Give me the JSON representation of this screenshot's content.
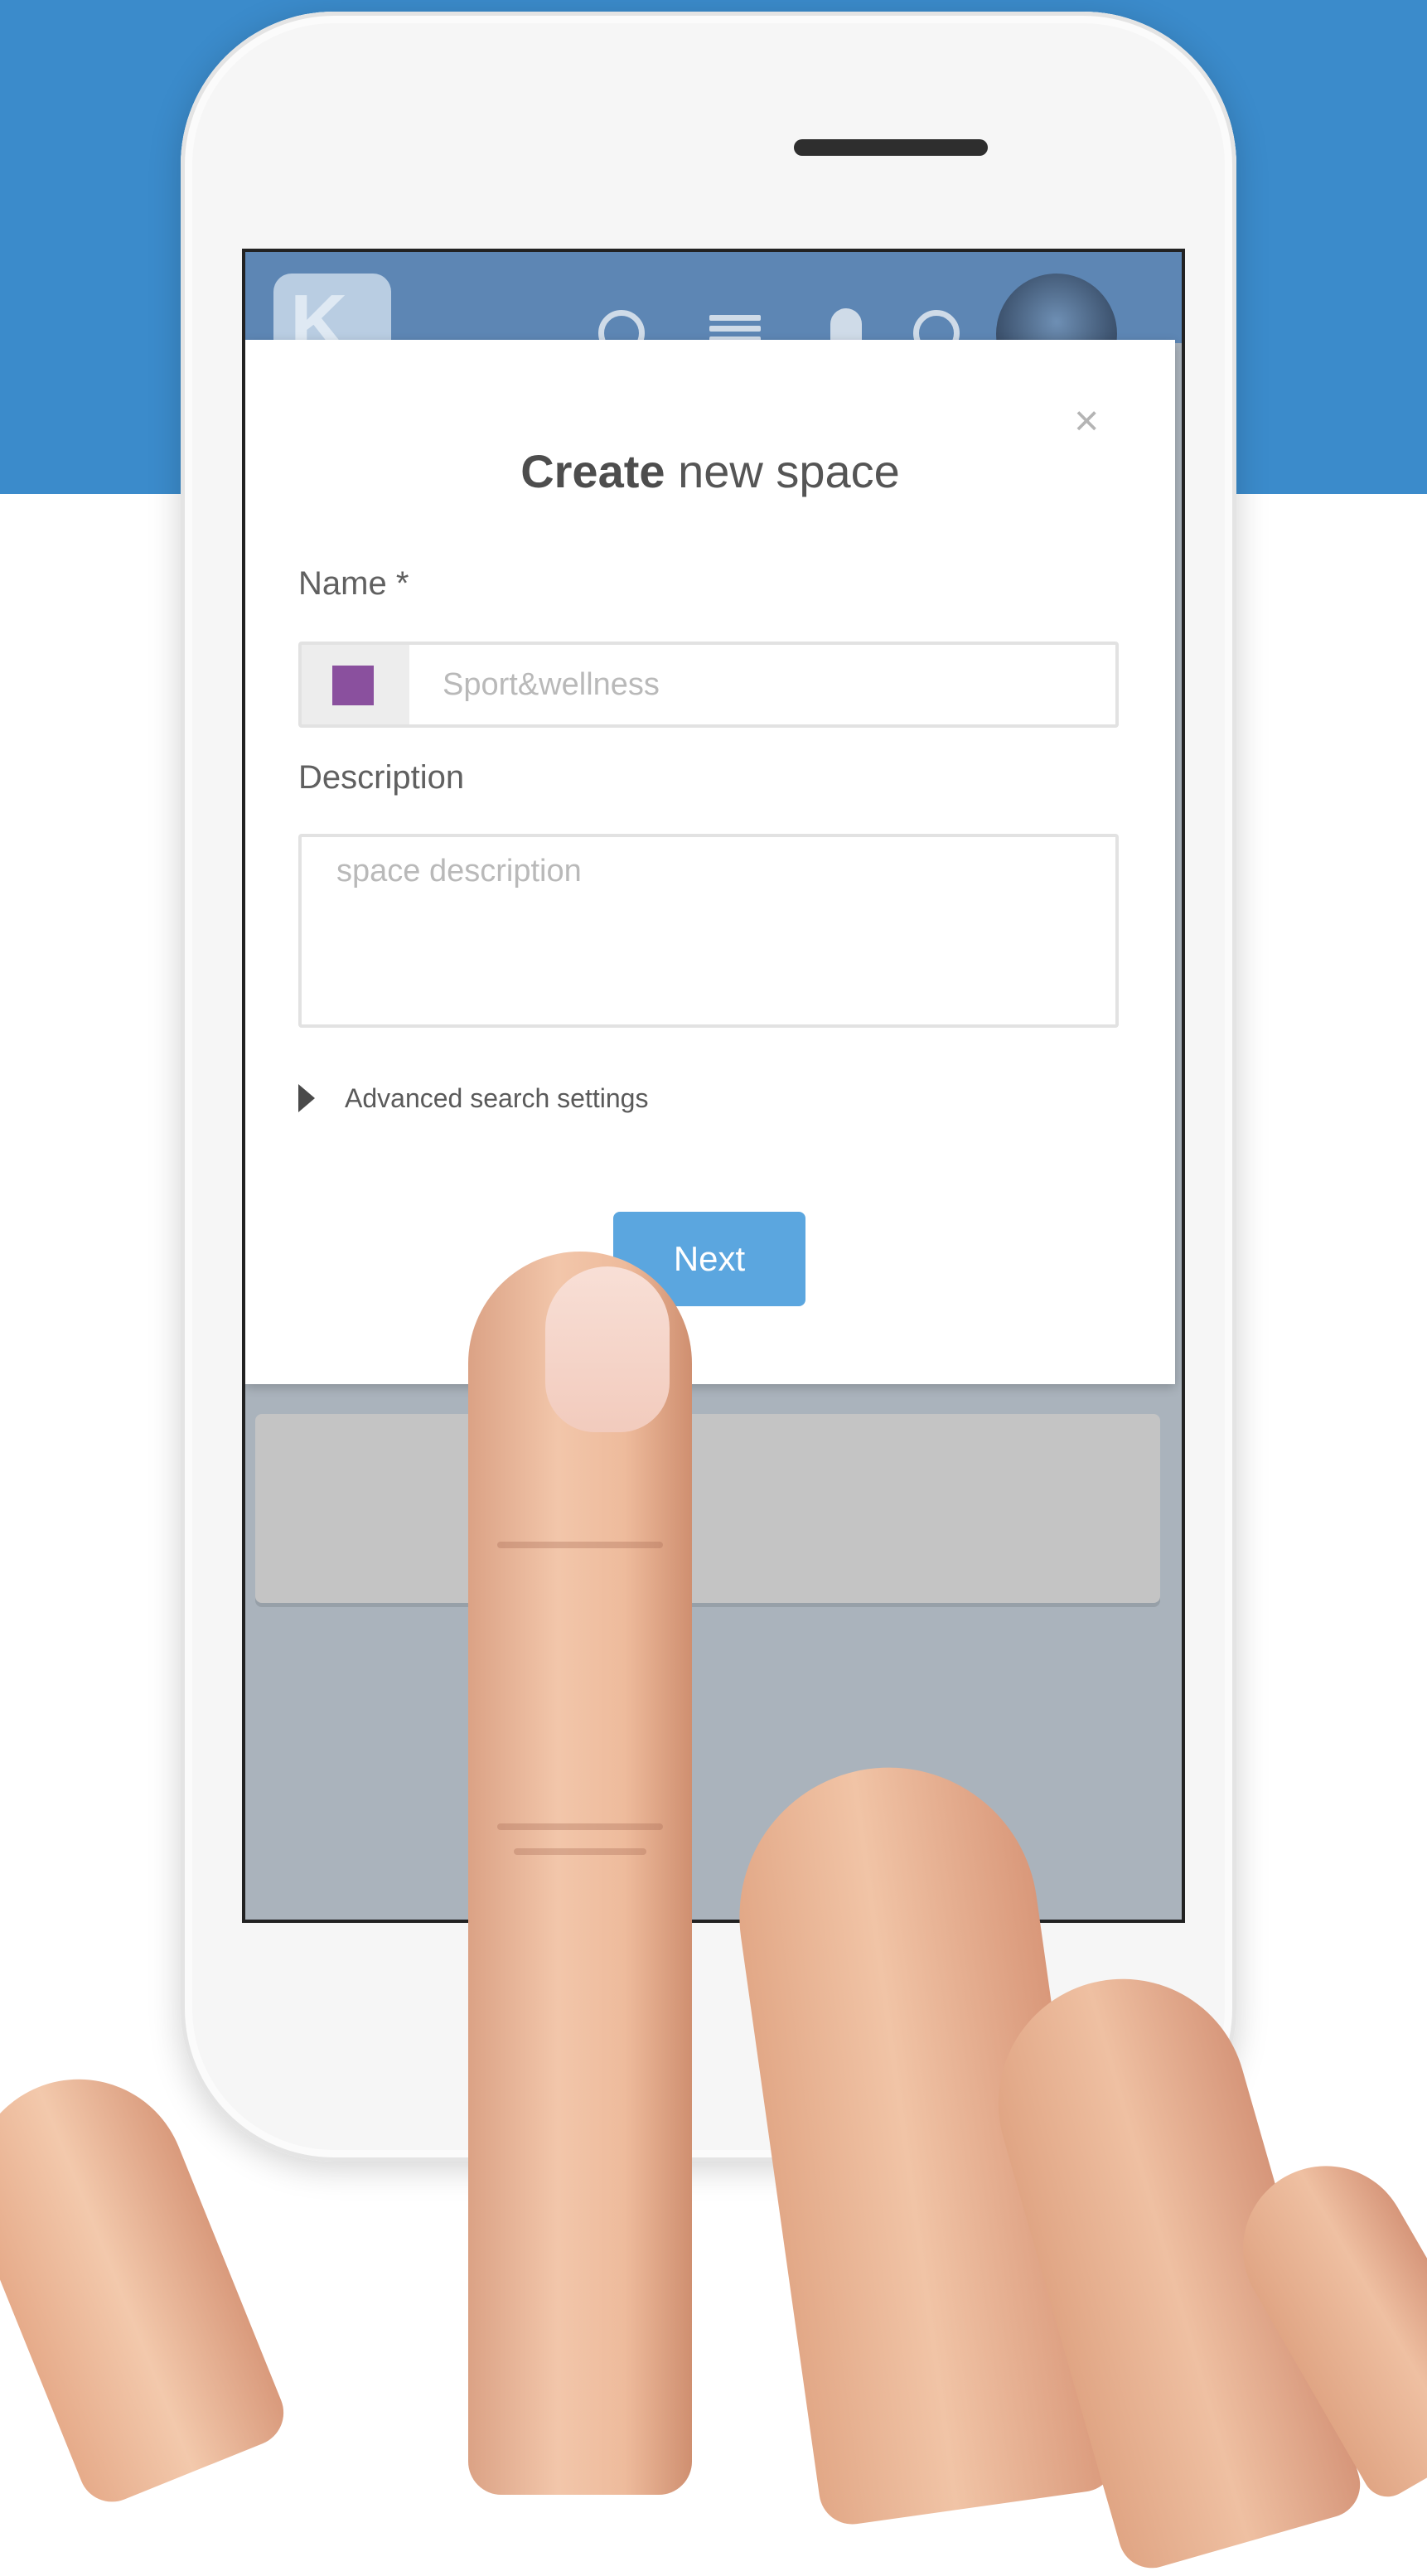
{
  "modal": {
    "title_bold": "Create",
    "title_rest": " new space",
    "close_glyph": "×",
    "name_label": "Name *",
    "name_placeholder": "Sport&wellness",
    "space_color": "#8a509e",
    "description_label": "Description",
    "description_placeholder": "space description",
    "advanced_label": "Advanced search settings",
    "next_label": "Next"
  },
  "colors": {
    "header_bg": "#3b8bcb",
    "primary_button": "#5ba6df"
  },
  "icons": [
    "logo-icon",
    "map-pin-icon",
    "menu-icon",
    "bell-icon",
    "search-icon",
    "close-icon",
    "caret-right-icon"
  ]
}
